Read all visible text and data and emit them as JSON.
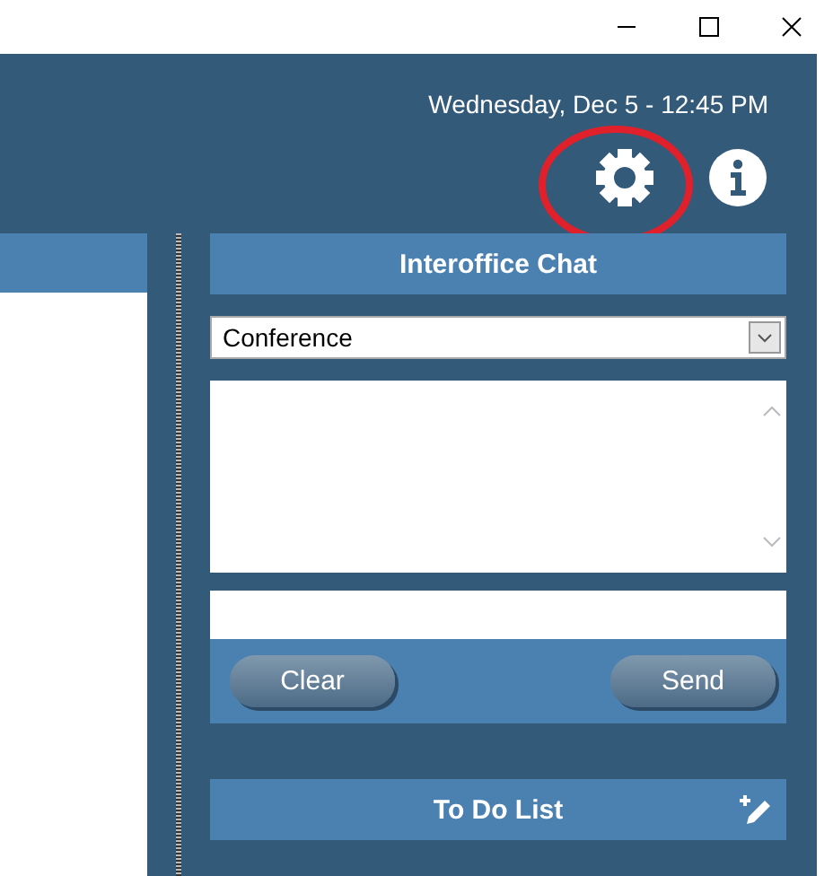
{
  "header": {
    "datetime": "Wednesday, Dec 5 - 12:45 PM"
  },
  "chat": {
    "title": "Interoffice Chat",
    "room": {
      "value": "Conference"
    },
    "buttons": [
      "Clear",
      "Send"
    ]
  },
  "todo": {
    "title": "To Do List"
  }
}
